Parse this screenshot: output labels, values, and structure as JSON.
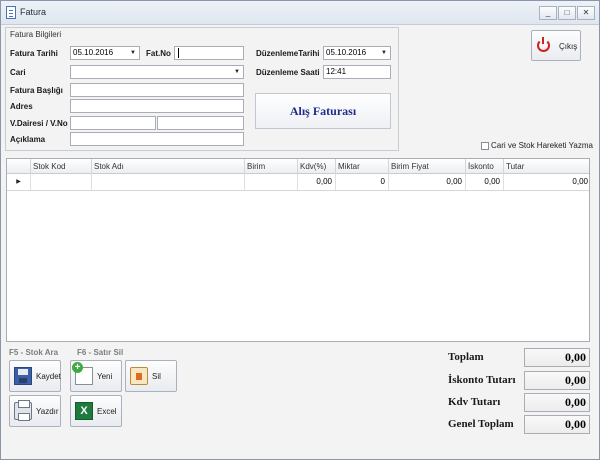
{
  "window": {
    "title": "Fatura",
    "minimize": "_",
    "maximize": "□",
    "close": "✕"
  },
  "group": {
    "title": "Fatura Bilgileri",
    "fatura_tarihi_label": "Fatura Tarihi",
    "fatura_tarihi_value": "05.10.2016",
    "fat_no_label": "Fat.No",
    "fat_no_value": "",
    "cari_label": "Cari",
    "cari_value": "",
    "fatura_basligi_label": "Fatura Başlığı",
    "fatura_basligi_value": "",
    "adres_label": "Adres",
    "adres_value": "",
    "vdairesi_label": "V.Dairesi / V.No",
    "vdairesi_value": "",
    "vno_value": "",
    "aciklama_label": "Açıklama",
    "aciklama_value": "",
    "duzenleme_tarihi_label": "DüzenlemeTarihi",
    "duzenleme_tarihi_value": "05.10.2016",
    "duzenleme_saati_label": "Düzenleme Saati",
    "duzenleme_saati_value": "12:41",
    "invoice_type": "Alış Faturası"
  },
  "exit_label": "Çıkış",
  "checkbox_label": "Cari ve Stok Hareketi Yazma",
  "grid": {
    "columns": [
      "Stok Kod",
      "Stok Adı",
      "Birim",
      "Kdv(%)",
      "Miktar",
      "Birim Fiyat",
      "İskonto",
      "Tutar"
    ],
    "row_indicator": "▶",
    "rows": [
      [
        "",
        "",
        "",
        "0,00",
        "0",
        "0,00",
        "0,00",
        "0,00"
      ]
    ]
  },
  "hints": {
    "f5": "F5 - Stok Ara",
    "f6": "F6 - Satır Sil"
  },
  "buttons": {
    "kaydet": "Kaydet",
    "yeni": "Yeni",
    "sil": "Sil",
    "yazdir": "Yazdır",
    "excel": "Excel",
    "excel_glyph": "X"
  },
  "totals": {
    "toplam_label": "Toplam",
    "toplam_value": "0,00",
    "iskonto_label": "İskonto Tutarı",
    "iskonto_value": "0,00",
    "kdv_label": "Kdv Tutarı",
    "kdv_value": "0,00",
    "genel_label": "Genel Toplam",
    "genel_value": "0,00"
  },
  "icons": {
    "window": "document-icon",
    "exit": "power-icon",
    "save": "floppy-disk-icon",
    "new": "new-document-icon",
    "delete": "delete-icon",
    "print": "printer-icon",
    "excel": "excel-icon"
  }
}
